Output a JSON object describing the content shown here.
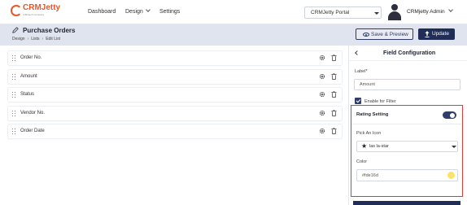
{
  "brand": {
    "name": "CRMJetty",
    "tagline": "A Biztech Company"
  },
  "nav": {
    "items": [
      {
        "label": "Dashboard",
        "has_dropdown": false
      },
      {
        "label": "Design",
        "has_dropdown": true
      },
      {
        "label": "Settings",
        "has_dropdown": false
      }
    ],
    "portal_select": "CRMJetty Portal",
    "user_name": "CRMjetty Admin"
  },
  "page": {
    "title": "Purchase Orders",
    "breadcrumb": [
      "Design",
      "Lists",
      "Edit List"
    ],
    "save_preview_label": "Save & Preview",
    "update_label": "Update"
  },
  "fields": [
    {
      "label": "Order No."
    },
    {
      "label": "Amount"
    },
    {
      "label": "Status"
    },
    {
      "label": "Vendor No."
    },
    {
      "label": "Order Date"
    }
  ],
  "panel": {
    "title": "Field Configuration",
    "label_caption": "Label*",
    "label_value": "Amount",
    "enable_filter_label": "Enable for Filter",
    "enable_filter_checked": true,
    "rating": {
      "title": "Rating Setting",
      "enabled": true,
      "icon_caption": "Pick An Icon",
      "icon_value": "las la-star",
      "color_caption": "Color",
      "color_value": "#fde16d"
    }
  },
  "colors": {
    "accent": "#1f2d57",
    "brand": "#e8572a",
    "header_band": "#dfe4ee",
    "highlight_border": "#e53935",
    "swatch": "#fde16d"
  }
}
